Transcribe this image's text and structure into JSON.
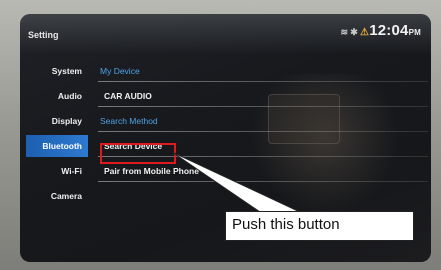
{
  "screen": {
    "title": "Setting",
    "status": {
      "time": "12:04",
      "ampm": "PM"
    }
  },
  "sidebar": {
    "items": [
      {
        "label": "System",
        "active": false
      },
      {
        "label": "Audio",
        "active": false
      },
      {
        "label": "Display",
        "active": false
      },
      {
        "label": "Bluetooth",
        "active": true
      },
      {
        "label": "Wi-Fi",
        "active": false
      },
      {
        "label": "Camera",
        "active": false
      }
    ]
  },
  "content": {
    "my_device_header": "My Device",
    "device_name": "CAR AUDIO",
    "search_method_header": "Search Method",
    "search_device": "Search Device",
    "pair_from_phone": "Pair from Mobile Phone"
  },
  "annotation": {
    "callout_text": "Push this button",
    "highlight_color": "#e0191e"
  },
  "colors": {
    "accent_header": "#4fa3e6",
    "active_tab": "#2e7ad0"
  }
}
